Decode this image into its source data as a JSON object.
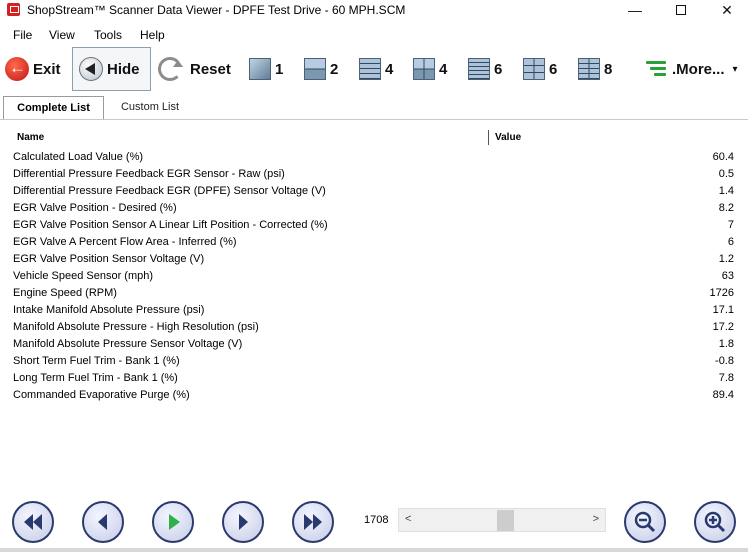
{
  "window": {
    "title": "ShopStream™ Scanner Data Viewer - DPFE Test Drive - 60 MPH.SCM",
    "minimize_glyph": "—",
    "close_glyph": "✕"
  },
  "menu": [
    "File",
    "View",
    "Tools",
    "Help"
  ],
  "toolbar": {
    "exit_label": "Exit",
    "hide_label": "Hide",
    "reset_label": "Reset",
    "layouts": [
      "1",
      "2",
      "4",
      "4",
      "6",
      "6",
      "8"
    ],
    "more_label": ".More...",
    "more_dropdown_glyph": "▾"
  },
  "tabs": {
    "complete": "Complete List",
    "custom": "Custom List",
    "active": "complete"
  },
  "table": {
    "col_name": "Name",
    "col_value": "Value",
    "rows": [
      {
        "name": "Calculated Load Value (%)",
        "value": "60.4"
      },
      {
        "name": "Differential Pressure Feedback EGR Sensor - Raw (psi)",
        "value": "0.5"
      },
      {
        "name": "Differential Pressure Feedback EGR (DPFE) Sensor Voltage (V)",
        "value": "1.4"
      },
      {
        "name": "EGR Valve Position - Desired (%)",
        "value": "8.2"
      },
      {
        "name": "EGR Valve Position Sensor A Linear Lift Position - Corrected (%)",
        "value": "7"
      },
      {
        "name": "EGR Valve A Percent Flow Area - Inferred (%)",
        "value": "6"
      },
      {
        "name": "EGR Valve Position Sensor Voltage (V)",
        "value": "1.2"
      },
      {
        "name": "Vehicle Speed Sensor (mph)",
        "value": "63"
      },
      {
        "name": "Engine Speed (RPM)",
        "value": "1726"
      },
      {
        "name": "Intake Manifold Absolute Pressure (psi)",
        "value": "17.1"
      },
      {
        "name": "Manifold Absolute Pressure - High Resolution (psi)",
        "value": "17.2"
      },
      {
        "name": "Manifold Absolute Pressure Sensor Voltage (V)",
        "value": "1.8"
      },
      {
        "name": "Short Term Fuel Trim - Bank 1 (%)",
        "value": "-0.8"
      },
      {
        "name": "Long Term Fuel Trim - Bank 1 (%)",
        "value": "7.8"
      },
      {
        "name": "Commanded Evaporative Purge (%)",
        "value": "89.4"
      }
    ]
  },
  "playback": {
    "frame": "1708",
    "scroll_left_glyph": "<",
    "scroll_right_glyph": ">"
  },
  "colors": {
    "exit_red": "#c0141a",
    "more_green": "#27a33a",
    "nav_ring": "#2a3a6e",
    "play_green": "#2fb04a"
  }
}
